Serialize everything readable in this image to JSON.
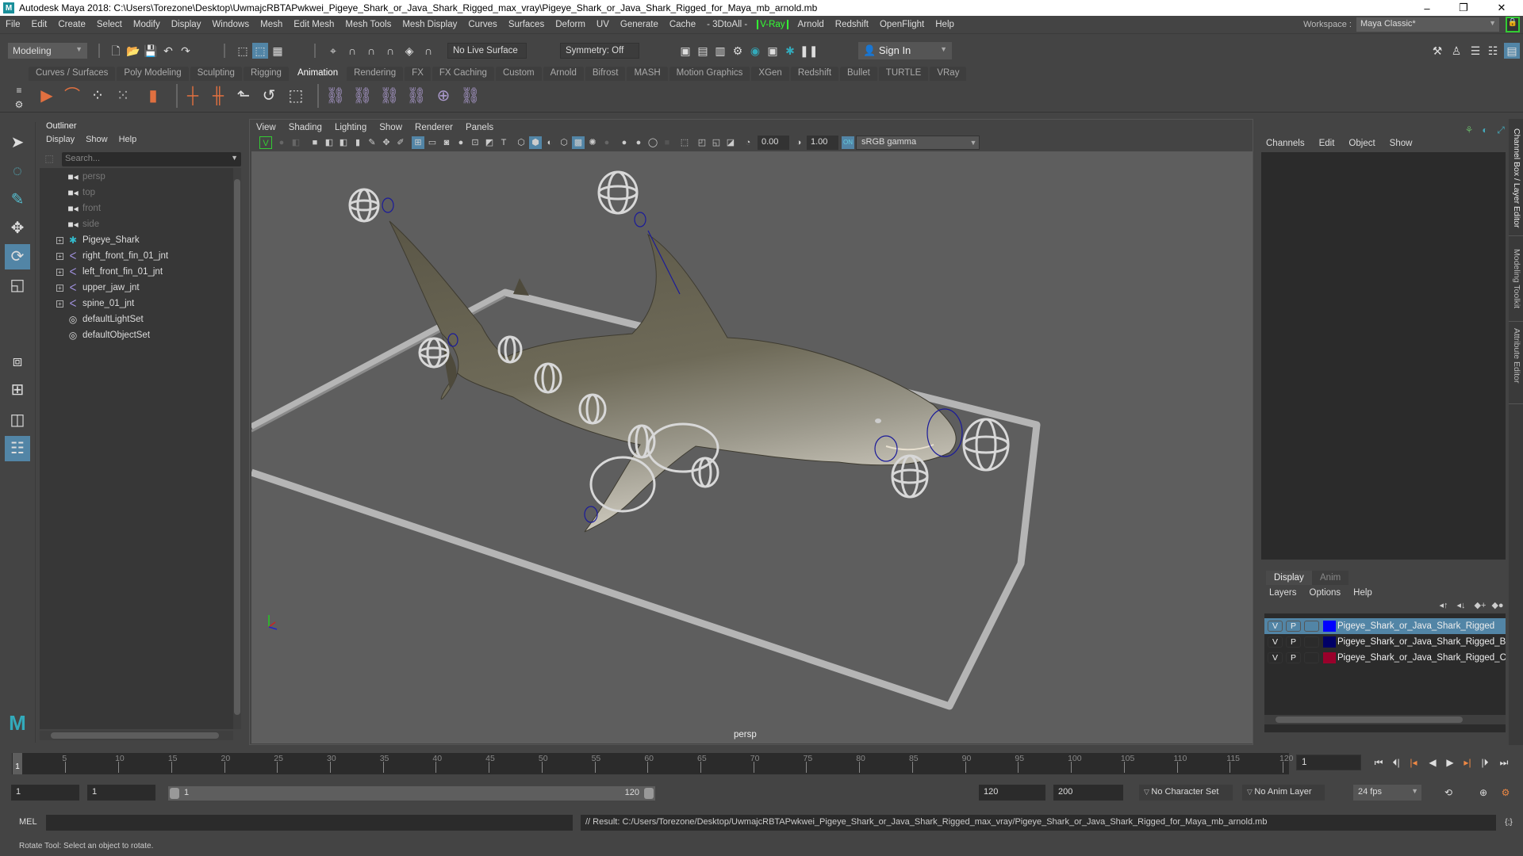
{
  "window": {
    "title": "Autodesk Maya 2018: C:\\Users\\Torezone\\Desktop\\UwmajcRBTAPwkwei_Pigeye_Shark_or_Java_Shark_Rigged_max_vray\\Pigeye_Shark_or_Java_Shark_Rigged_for_Maya_mb_arnold.mb",
    "app_icon": "maya-logo-icon",
    "controls": {
      "minimize": "–",
      "restore": "❐",
      "close": "✕"
    }
  },
  "menubar": {
    "items": [
      "File",
      "Edit",
      "Create",
      "Select",
      "Modify",
      "Display",
      "Windows",
      "Mesh",
      "Edit Mesh",
      "Mesh Tools",
      "Mesh Display",
      "Curves",
      "Surfaces",
      "Deform",
      "UV",
      "Generate",
      "Cache",
      "- 3DtoAll -",
      "V-Ray",
      "Arnold",
      "Redshift",
      "OpenFlight",
      "Help"
    ],
    "workspace_label": "Workspace :",
    "workspace_value": "Maya Classic*",
    "lock_icon": "🔒"
  },
  "statusline": {
    "mode": "Modeling",
    "live_surface": "No Live Surface",
    "symmetry": "Symmetry: Off",
    "sign_in": "Sign In"
  },
  "shelf": {
    "tabs": [
      "Curves / Surfaces",
      "Poly Modeling",
      "Sculpting",
      "Rigging",
      "Animation",
      "Rendering",
      "FX",
      "FX Caching",
      "Custom",
      "Arnold",
      "Bifrost",
      "MASH",
      "Motion Graphics",
      "XGen",
      "Redshift",
      "Bullet",
      "TURTLE",
      "VRay"
    ],
    "active_tab": "Animation"
  },
  "outliner": {
    "title": "Outliner",
    "menu": [
      "Display",
      "Show",
      "Help"
    ],
    "search_placeholder": "Search...",
    "items": [
      {
        "label": "persp",
        "icon": "camera-icon",
        "dim": true,
        "expandable": false
      },
      {
        "label": "top",
        "icon": "camera-icon",
        "dim": true,
        "expandable": false
      },
      {
        "label": "front",
        "icon": "camera-icon",
        "dim": true,
        "expandable": false
      },
      {
        "label": "side",
        "icon": "camera-icon",
        "dim": true,
        "expandable": false
      },
      {
        "label": "Pigeye_Shark",
        "icon": "transform-icon",
        "dim": false,
        "expandable": true
      },
      {
        "label": "right_front_fin_01_jnt",
        "icon": "joint-icon",
        "dim": false,
        "expandable": true
      },
      {
        "label": "left_front_fin_01_jnt",
        "icon": "joint-icon",
        "dim": false,
        "expandable": true
      },
      {
        "label": "upper_jaw_jnt",
        "icon": "joint-icon",
        "dim": false,
        "expandable": true
      },
      {
        "label": "spine_01_jnt",
        "icon": "joint-icon",
        "dim": false,
        "expandable": true
      },
      {
        "label": "defaultLightSet",
        "icon": "set-icon",
        "dim": false,
        "expandable": false
      },
      {
        "label": "defaultObjectSet",
        "icon": "set-icon",
        "dim": false,
        "expandable": false
      }
    ]
  },
  "viewport": {
    "menu": [
      "View",
      "Shading",
      "Lighting",
      "Show",
      "Renderer",
      "Panels"
    ],
    "exposure": "0.00",
    "gamma": "1.00",
    "color_space": "sRGB gamma",
    "camera_label": "persp",
    "axis": {
      "x": "x",
      "y": "y",
      "z": "z"
    }
  },
  "channelbox": {
    "menu": [
      "Channels",
      "Edit",
      "Object",
      "Show"
    ]
  },
  "layer_editor": {
    "tabs": [
      "Display",
      "Anim"
    ],
    "active_tab": "Display",
    "menu": [
      "Layers",
      "Options",
      "Help"
    ],
    "layers": [
      {
        "v": "V",
        "p": "P",
        "name": "Pigeye_Shark_or_Java_Shark_Rigged",
        "color": "#0000ff",
        "selected": true
      },
      {
        "v": "V",
        "p": "P",
        "name": "Pigeye_Shark_or_Java_Shark_Rigged_Bones",
        "color": "#000066",
        "selected": false
      },
      {
        "v": "V",
        "p": "P",
        "name": "Pigeye_Shark_or_Java_Shark_Rigged_Controllers",
        "color": "#99002b",
        "selected": false
      }
    ]
  },
  "side_tabs": [
    "Channel Box / Layer Editor",
    "Modeling Toolkit",
    "Attribute Editor"
  ],
  "timeline": {
    "ticks": [
      5,
      10,
      15,
      20,
      25,
      30,
      35,
      40,
      45,
      50,
      55,
      60,
      65,
      70,
      75,
      80,
      85,
      90,
      95,
      100,
      105,
      110,
      115,
      120
    ],
    "start": 1,
    "end": 120,
    "current_frame": "1",
    "current_frame_field": "1"
  },
  "range": {
    "start_time": "1",
    "playback_start": "1",
    "slider_start": "1",
    "slider_end": "120",
    "playback_end": "120",
    "end_time": "200",
    "character_set": "No Character Set",
    "anim_layer": "No Anim Layer",
    "fps": "24 fps"
  },
  "command": {
    "lang": "MEL",
    "input_value": "",
    "result": "// Result: C:/Users/Torezone/Desktop/UwmajcRBTAPwkwei_Pigeye_Shark_or_Java_Shark_Rigged_max_vray/Pigeye_Shark_or_Java_Shark_Rigged_for_Maya_mb_arnold.mb"
  },
  "help_line": "Rotate Tool: Select an object to rotate.",
  "colors": {
    "accent": "#5285a6",
    "vray_green": "#33ff33",
    "panel": "#444444",
    "viewport_bg": "#5e5e5e"
  }
}
